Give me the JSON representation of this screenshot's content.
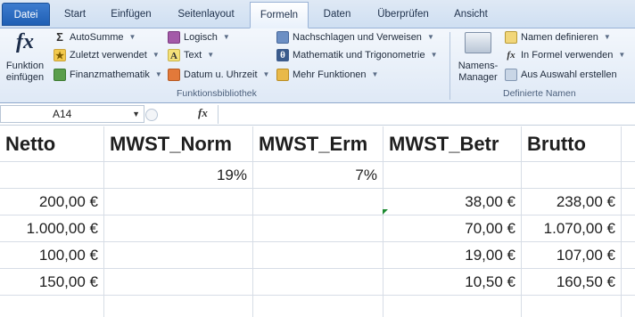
{
  "tabs": [
    "Datei",
    "Start",
    "Einfügen",
    "Seitenlayout",
    "Formeln",
    "Daten",
    "Überprüfen",
    "Ansicht"
  ],
  "active_tab": "Formeln",
  "ribbon": {
    "insert_function": {
      "line1": "Funktion",
      "line2": "einfügen"
    },
    "library_buttons": {
      "autosumme": "AutoSumme",
      "zuletzt": "Zuletzt verwendet",
      "finanz": "Finanzmathematik",
      "logisch": "Logisch",
      "text": "Text",
      "datum": "Datum u. Uhrzeit",
      "nachschlagen": "Nachschlagen und Verweisen",
      "mathematik": "Mathematik und Trigonometrie",
      "mehr": "Mehr Funktionen"
    },
    "library_group_label": "Funktionsbibliothek",
    "name_manager": {
      "line1": "Namens-",
      "line2": "Manager"
    },
    "names_buttons": {
      "definieren": "Namen definieren",
      "formel": "In Formel verwenden",
      "auswahl": "Aus Auswahl erstellen"
    },
    "names_group_label": "Definierte Namen"
  },
  "formula_bar": {
    "name_box": "A14",
    "fx_label": "fx",
    "formula": ""
  },
  "sheet": {
    "headers": [
      "Netto",
      "MWST_Norm",
      "MWST_Erm",
      "MWST_Betr",
      "Brutto"
    ],
    "rates": [
      "",
      "19%",
      "7%",
      "",
      ""
    ],
    "rows": [
      [
        "200,00 €",
        "",
        "",
        "38,00 €",
        "238,00 €"
      ],
      [
        "1.000,00 €",
        "",
        "",
        "70,00 €",
        "1.070,00 €"
      ],
      [
        "100,00 €",
        "",
        "",
        "19,00 €",
        "107,00 €"
      ],
      [
        "150,00 €",
        "",
        "",
        "10,50 €",
        "160,50 €"
      ],
      [
        "",
        "",
        "",
        "",
        ""
      ]
    ]
  },
  "colors": {
    "file_tab": "#2a6cc4",
    "accent": "#1d8a32"
  }
}
